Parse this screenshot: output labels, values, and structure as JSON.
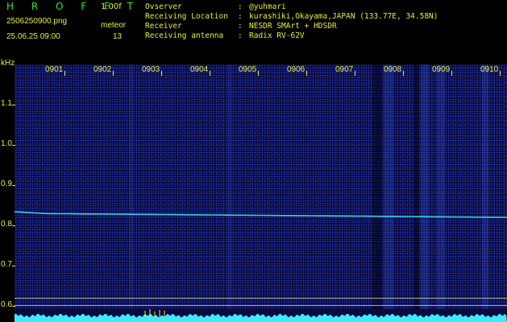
{
  "app": {
    "title": "H R O F F T",
    "version": "1.00f",
    "file_name": "2506250900.png",
    "datetime": "25.06.25 09:00",
    "meteor_label": "meteor",
    "meteor_count": "13"
  },
  "info": [
    {
      "key": "Ovserver",
      "value": "@yuhmari"
    },
    {
      "key": "Receiving Location",
      "value": "kurashiki,Okayama,JAPAN (133.77E, 34.58N)"
    },
    {
      "key": "Receiver",
      "value": "NESDR SMArt + HDSDR"
    },
    {
      "key": "Receiving antenna",
      "value": "Radix RV-62V"
    }
  ],
  "colon": ":",
  "spectrogram": {
    "y_unit": "kHz",
    "y_ticks": [
      "1.1",
      "1.0",
      "0.9",
      "0.8",
      "0.7",
      "0.6"
    ],
    "x_ticks": [
      "0901",
      "0902",
      "0903",
      "0904",
      "0905",
      "0906",
      "0907",
      "0908",
      "0909",
      "0910"
    ],
    "signal_trace_khz": {
      "start": 0.83,
      "end": 0.82
    },
    "colors": {
      "background": "#0a0a3e",
      "noise": "#3c5aff",
      "trace": "#38e0ff",
      "text": "#e8ec3c",
      "title": "#2ee63a",
      "baseline": "#3fe8ff"
    }
  }
}
